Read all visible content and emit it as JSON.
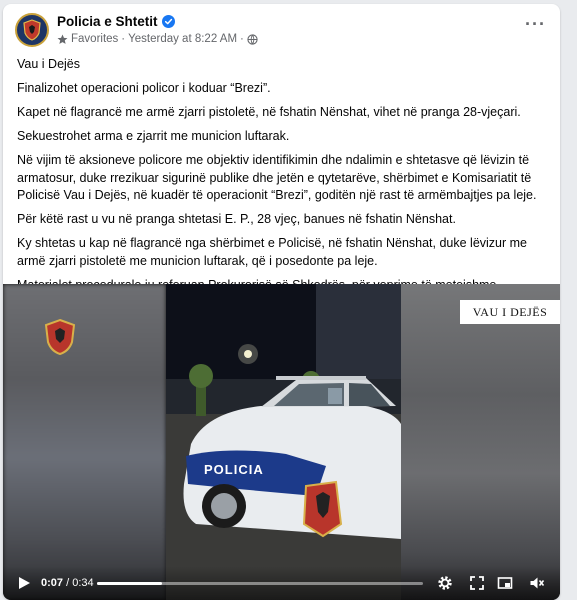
{
  "post": {
    "page_name": "Policia e Shtetit",
    "favorites_label": "Favorites",
    "separator": "·",
    "timestamp": "Yesterday at 8:22 AM",
    "audience": "public",
    "more_label": "···"
  },
  "text": {
    "paragraphs": [
      "Vau i Dejës",
      "Finalizohet operacioni policor i koduar “Brezi”.",
      "Kapet në flagrancë me armë zjarri pistoletë, në fshatin Nënshat, vihet në pranga 28-vjeçari.",
      "Sekuestrohet arma e zjarrit me municion luftarak.",
      "Në vijim të aksioneve policore me objektiv identifikimin dhe ndalimin e shtetasve që lëvizin të armatosur, duke rrezikuar sigurinë publike dhe jetën e qytetarëve, shërbimet e Komisariatit të Policisë Vau i Dejës, në kuadër të operacionit “Brezi”, goditën një rast të armëmbajtjes pa leje.",
      "Për këtë rast u vu në pranga shtetasi E. P., 28 vjeç, banues në fshatin Nënshat.",
      "Ky shtetas u kap në flagrancë nga shërbimet e Policisë, në fshatin Nënshat, duke lëvizur me armë zjarri pistoletë me municion luftarak, që i posedonte pa leje.",
      "Materialet procedurale iu referuan Prokurorisë së Shkodrës, për veprime të metejshme."
    ]
  },
  "video": {
    "watermark": "VAU I DEJËS",
    "car_text": "POLICIA",
    "current_time": "0:07",
    "duration": "0:34",
    "time_separator": " / ",
    "progress": 0.2
  },
  "colors": {
    "verified": "#1877f2",
    "meta": "#65676b",
    "police_blue": "#1e3565"
  }
}
